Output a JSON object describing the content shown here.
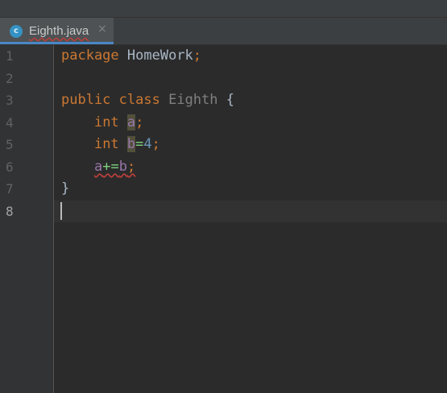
{
  "tab": {
    "icon_letter": "c",
    "title": "Eighth.java",
    "close_glyph": "×"
  },
  "gutter": {
    "line_numbers": [
      "1",
      "2",
      "3",
      "4",
      "5",
      "6",
      "7",
      "8"
    ],
    "current_line": "8"
  },
  "code": {
    "line1": {
      "kw": "package",
      "name": "HomeWork",
      "semi": ";"
    },
    "line3": {
      "kw1": "public",
      "kw2": "class",
      "name": "Eighth",
      "brace": "{"
    },
    "line4": {
      "kw": "int",
      "var": "a",
      "semi": ";"
    },
    "line5": {
      "kw": "int",
      "var": "b",
      "eq": "=",
      "num": "4",
      "semi": ";"
    },
    "line6": {
      "var1": "a",
      "op": "+=",
      "var2": "b",
      "semi": ";"
    },
    "line7": {
      "brace": "}"
    }
  },
  "colors": {
    "keyword": "#cc7832",
    "identifier": "#a9b7c6",
    "number": "#6897bb",
    "field": "#9876aa",
    "error": "#bc3f3c",
    "tab_accent": "#4a88c7"
  }
}
